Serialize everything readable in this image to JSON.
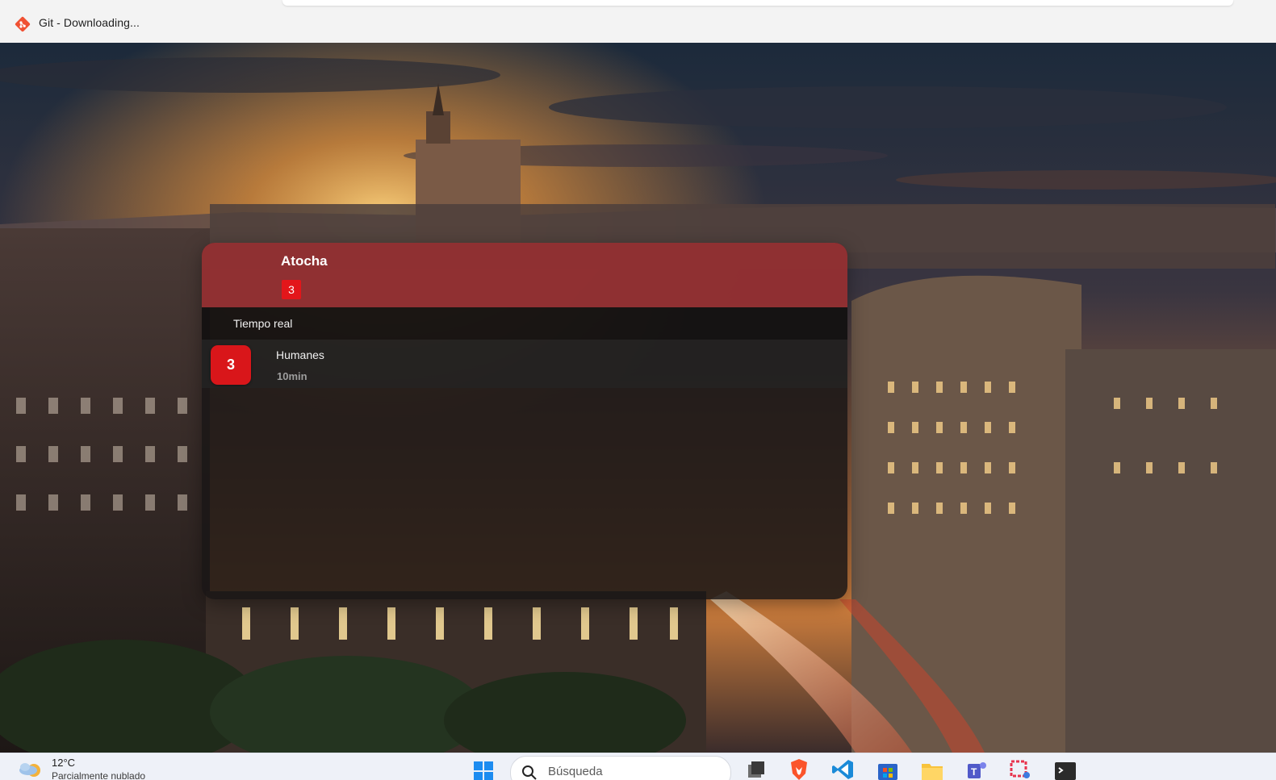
{
  "window": {
    "title": "Git - Downloading...",
    "icon": "git-icon"
  },
  "card": {
    "station_name": "Atocha",
    "header_line_badge": "3",
    "section_label": "Tiempo real",
    "arrivals": [
      {
        "line": "3",
        "destination": "Humanes",
        "eta": "10min"
      }
    ]
  },
  "taskbar": {
    "weather": {
      "temp": "12°C",
      "description": "Parcialmente nublado",
      "icon": "partly-cloudy-icon"
    },
    "search_placeholder": "Búsqueda",
    "pinned_apps": [
      "start-icon",
      "task-view-icon",
      "brave-icon",
      "vscode-icon",
      "store-icon",
      "file-explorer-icon",
      "teams-icon",
      "snipping-tool-icon",
      "terminal-icon"
    ]
  },
  "colors": {
    "header_red": "#983234",
    "line_3_red": "#d9161a",
    "panel_dark": "#1a1616"
  }
}
